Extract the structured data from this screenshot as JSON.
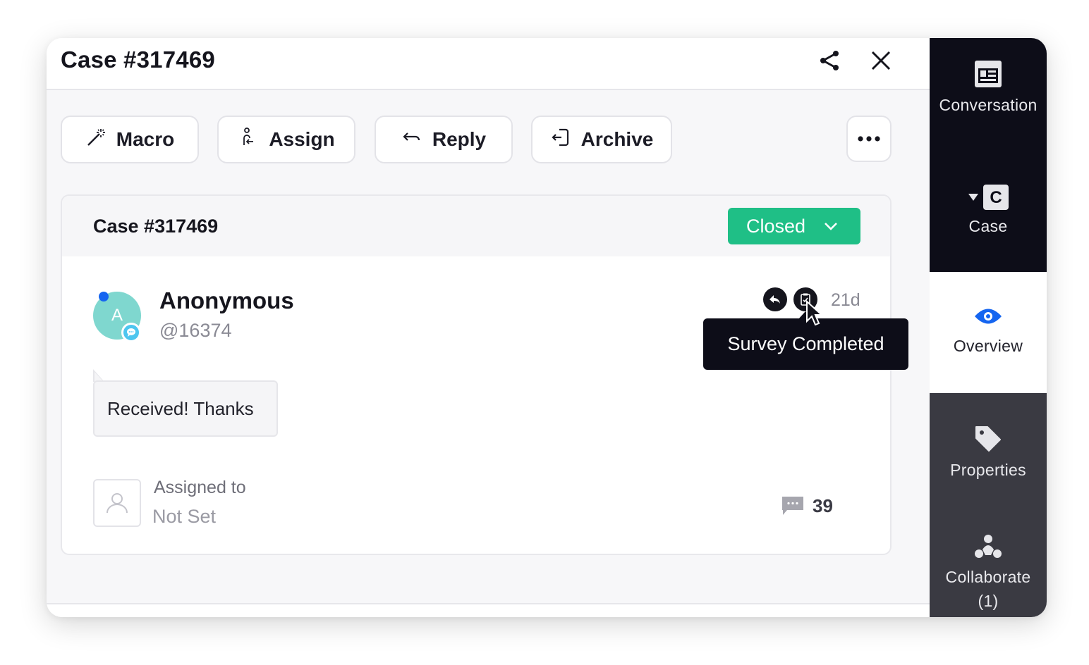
{
  "header": {
    "title": "Case #317469",
    "share_icon": "share-icon",
    "close_icon": "close-icon"
  },
  "toolbar": {
    "buttons": [
      {
        "label": "Macro",
        "icon": "magic-wand-icon"
      },
      {
        "label": "Assign",
        "icon": "assign-person-icon"
      },
      {
        "label": "Reply",
        "icon": "reply-arrow-icon"
      },
      {
        "label": "Archive",
        "icon": "archive-exit-icon"
      }
    ],
    "more_icon": "more-horizontal-icon"
  },
  "case_card": {
    "title": "Case #317469",
    "status": {
      "label": "Closed",
      "color": "#1fbf86"
    },
    "customer": {
      "avatar_initial": "A",
      "name": "Anonymous",
      "handle": "@16374",
      "presence_color": "#1565f0",
      "avatar_color": "#7fd7cf"
    },
    "age": "21d",
    "message": "Received! Thanks",
    "assigned_label": "Assigned to",
    "assigned_value": "Not Set",
    "comment_count": "39"
  },
  "tooltip": {
    "text": "Survey Completed"
  },
  "sidebar": {
    "items": [
      {
        "label": "Conversation",
        "icon": "conversation-card-icon",
        "state": "dark"
      },
      {
        "label": "Case",
        "icon": "case-c-icon",
        "state": "dark"
      },
      {
        "label": "Overview",
        "icon": "eye-icon",
        "state": "active"
      },
      {
        "label": "Properties",
        "icon": "tag-icon",
        "state": "gray"
      },
      {
        "label": "Collaborate",
        "count": "(1)",
        "icon": "collaborate-icon",
        "state": "gray"
      }
    ],
    "accent_color": "#1565f0"
  }
}
